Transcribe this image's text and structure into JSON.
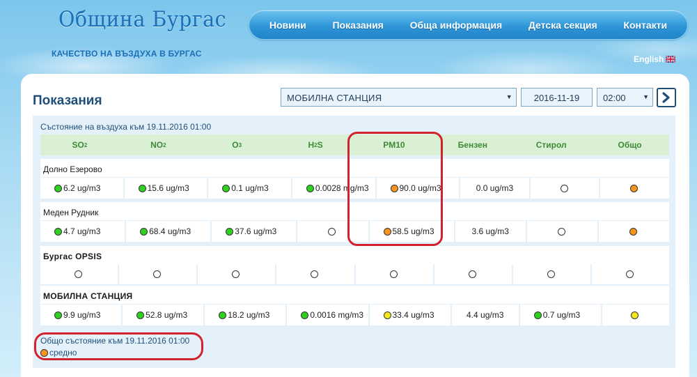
{
  "header": {
    "logo": "Община Бургас",
    "tagline": "КАЧЕСТВО НА ВЪЗДУХА В БУРГАС",
    "language": "English",
    "nav": [
      "Новини",
      "Показания",
      "Обща информация",
      "Детска секция",
      "Контакти"
    ]
  },
  "page": {
    "title": "Показания",
    "station_select": "МОБИЛНА СТАНЦИЯ",
    "date": "2016-11-19",
    "time": "02:00"
  },
  "table": {
    "status_time": "Състояние на въздуха към 19.11.2016 01:00",
    "columns": {
      "so2": "SO",
      "so2_sub": "2",
      "no2": "NO",
      "no2_sub": "2",
      "o3": "O",
      "o3_sub": "3",
      "h2s": "H",
      "h2s_sub": "2",
      "h2s_tail": "S",
      "pm10": "PM10",
      "benzene": "Бензен",
      "styrene": "Стирол",
      "overall": "Общо"
    },
    "stations": [
      {
        "name": "Долно Езерово",
        "cells": [
          {
            "status": "green",
            "value": "6.2 ug/m3"
          },
          {
            "status": "green",
            "value": "15.6 ug/m3"
          },
          {
            "status": "green",
            "value": "0.1 ug/m3"
          },
          {
            "status": "green",
            "value": "0.0028 mg/m3"
          },
          {
            "status": "orange",
            "value": "90.0 ug/m3"
          },
          {
            "status": "none",
            "value": "0.0 ug/m3"
          },
          {
            "status": "empty",
            "value": ""
          },
          {
            "status": "orange",
            "value": ""
          }
        ]
      },
      {
        "name": "Меден Рудник",
        "cells": [
          {
            "status": "green",
            "value": "4.7 ug/m3"
          },
          {
            "status": "green",
            "value": "68.4 ug/m3"
          },
          {
            "status": "green",
            "value": "37.6 ug/m3"
          },
          {
            "status": "empty",
            "value": ""
          },
          {
            "status": "orange",
            "value": "58.5 ug/m3"
          },
          {
            "status": "none",
            "value": "3.6 ug/m3"
          },
          {
            "status": "empty",
            "value": ""
          },
          {
            "status": "orange",
            "value": ""
          }
        ]
      },
      {
        "name": "Бургас OPSIS",
        "cells": [
          {
            "status": "empty",
            "value": ""
          },
          {
            "status": "empty",
            "value": ""
          },
          {
            "status": "empty",
            "value": ""
          },
          {
            "status": "empty",
            "value": ""
          },
          {
            "status": "empty",
            "value": ""
          },
          {
            "status": "empty",
            "value": ""
          },
          {
            "status": "empty",
            "value": ""
          },
          {
            "status": "empty",
            "value": ""
          }
        ]
      },
      {
        "name": "МОБИЛНА СТАНЦИЯ",
        "cells": [
          {
            "status": "green",
            "value": "9.9 ug/m3"
          },
          {
            "status": "green",
            "value": "52.8 ug/m3"
          },
          {
            "status": "green",
            "value": "18.2 ug/m3"
          },
          {
            "status": "green",
            "value": "0.0016 mg/m3"
          },
          {
            "status": "yellow",
            "value": "33.4 ug/m3"
          },
          {
            "status": "none",
            "value": "4.4 ug/m3"
          },
          {
            "status": "green",
            "value": "0.7 ug/m3"
          },
          {
            "status": "yellow",
            "value": ""
          }
        ]
      }
    ],
    "overall_label": "Общо състояние към 19.11.2016 01:00",
    "overall_status": "orange",
    "overall_text": "средно"
  },
  "colors": {
    "green": "#2fd11f",
    "orange": "#f7941d",
    "yellow": "#f4e819",
    "highlight": "#d2222d"
  }
}
